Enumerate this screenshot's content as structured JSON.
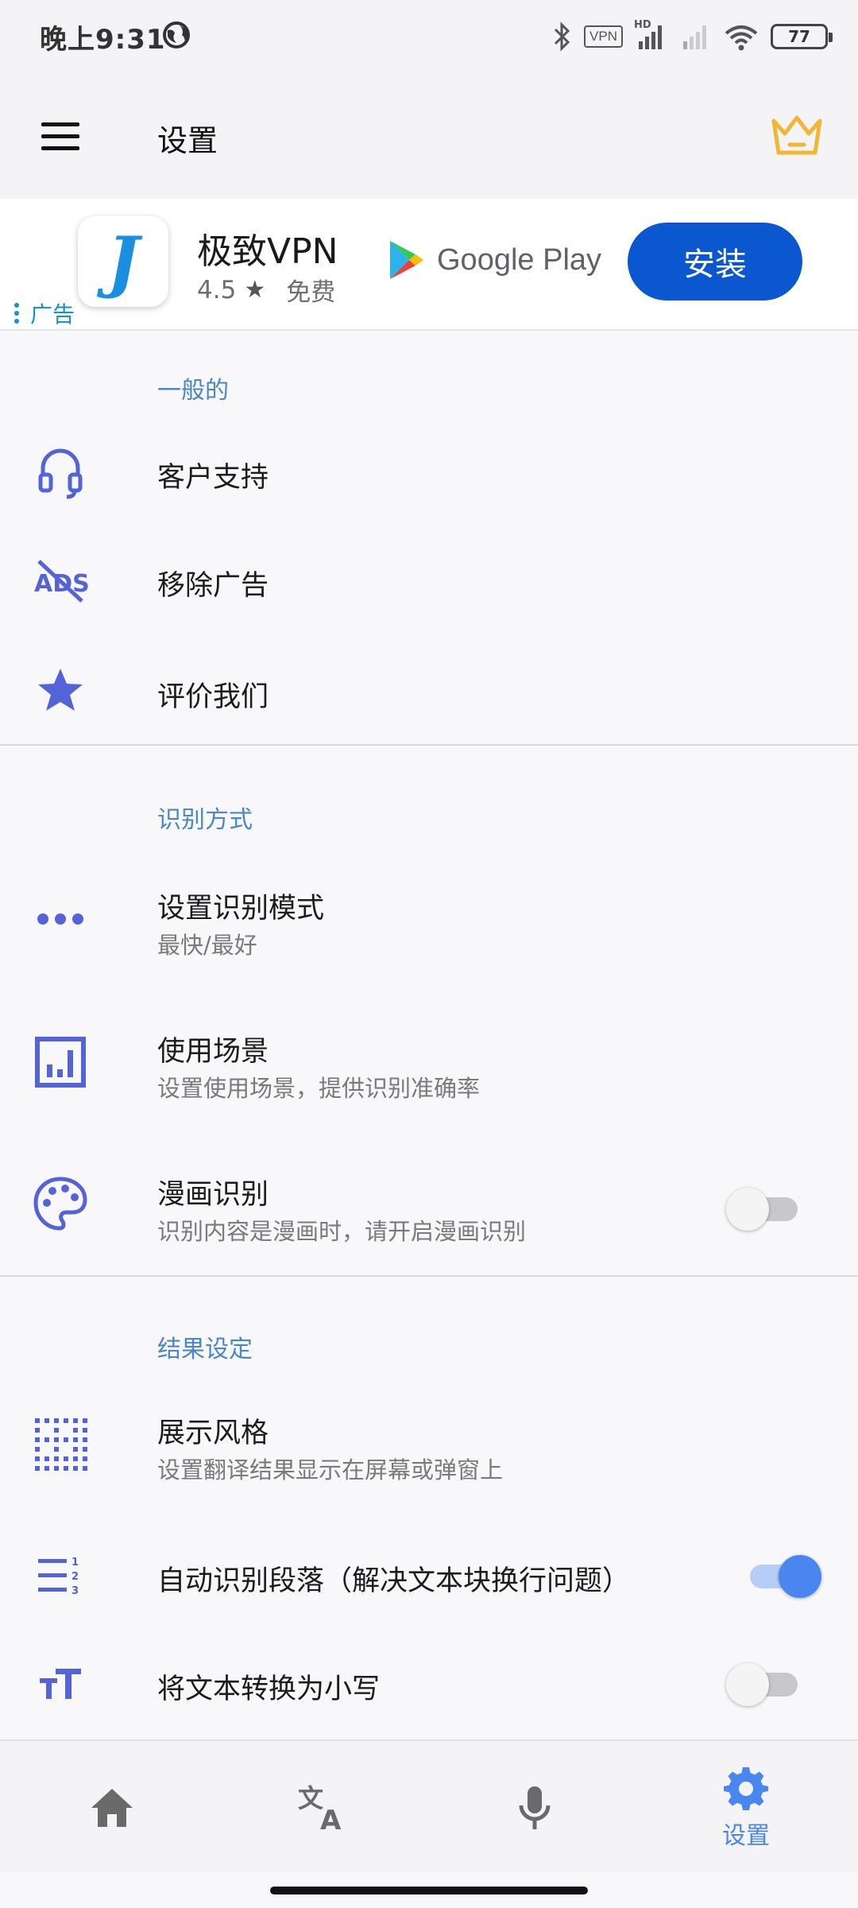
{
  "status_bar": {
    "time": "晚上9:31",
    "vpn_label": "VPN",
    "hd_label": "HD",
    "battery": "77"
  },
  "app_bar": {
    "title": "设置"
  },
  "ad": {
    "logo_letter": "J",
    "app_name": "极致VPN",
    "rating": "4.5",
    "star": "★",
    "price": "免费",
    "store": "Google Play",
    "install_label": "安装",
    "ad_tag": "广告"
  },
  "sections": {
    "general": {
      "header": "一般的",
      "support": "客户支持",
      "remove_ads": "移除广告",
      "rate_us": "评价我们"
    },
    "recognition": {
      "header": "识别方式",
      "mode_title": "设置识别模式",
      "mode_sub": "最快/最好",
      "scene_title": "使用场景",
      "scene_sub": "设置使用场景，提供识别准确率",
      "comic_title": "漫画识别",
      "comic_sub": "识别内容是漫画时，请开启漫画识别",
      "comic_enabled": false
    },
    "results": {
      "header": "结果设定",
      "style_title": "展示风格",
      "style_sub": "设置翻译结果显示在屏幕或弹窗上",
      "paragraph_title": "自动识别段落（解决文本块换行问题）",
      "paragraph_enabled": true,
      "lowercase_title": "将文本转换为小写",
      "lowercase_enabled": false
    }
  },
  "bottom_nav": {
    "items": [
      {
        "icon": "home-icon",
        "label": ""
      },
      {
        "icon": "translate-icon",
        "label": ""
      },
      {
        "icon": "microphone-icon",
        "label": ""
      },
      {
        "icon": "gear-icon",
        "label": "设置"
      }
    ]
  },
  "colors": {
    "accent": "#4a86f0",
    "icon_blue": "#5563d8",
    "section_header": "#4a86c8",
    "install_button": "#0b57d0",
    "crown": "#f2b632"
  }
}
